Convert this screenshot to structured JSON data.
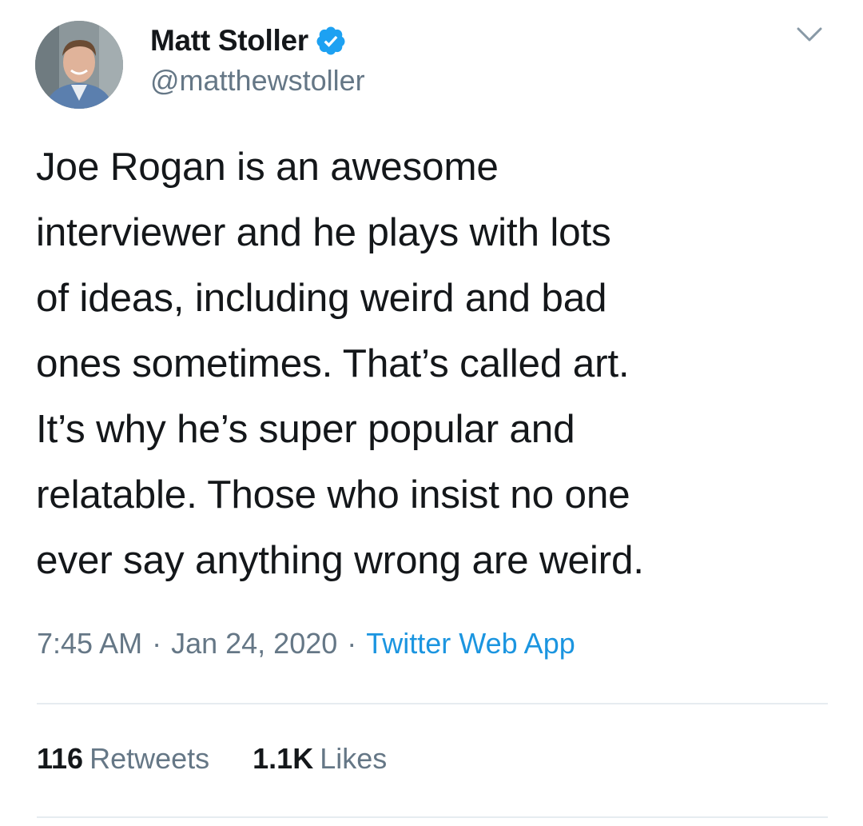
{
  "user": {
    "display_name": "Matt Stoller",
    "handle": "@matthewstoller",
    "verified": true,
    "avatar_icon": "profile-photo"
  },
  "tweet": {
    "text": "Joe Rogan is an awesome\ninterviewer and he plays with lots\nof ideas, including weird and bad\nones sometimes. That’s called art.\nIt’s why he’s super popular and\nrelatable. Those who insist no one\never say anything wrong are weird.",
    "time": "7:45 AM",
    "separator": "·",
    "date": "Jan 24, 2020",
    "source": "Twitter Web App"
  },
  "stats": {
    "retweets_count": "116",
    "retweets_label": "Retweets",
    "likes_count": "1.1K",
    "likes_label": "Likes"
  },
  "colors": {
    "text": "#14171a",
    "secondary": "#657786",
    "link": "#1b95e0",
    "verified": "#1da1f2",
    "divider": "#e6ecf0"
  },
  "icons": {
    "verified": "verified-badge-icon",
    "menu": "chevron-down-icon"
  }
}
